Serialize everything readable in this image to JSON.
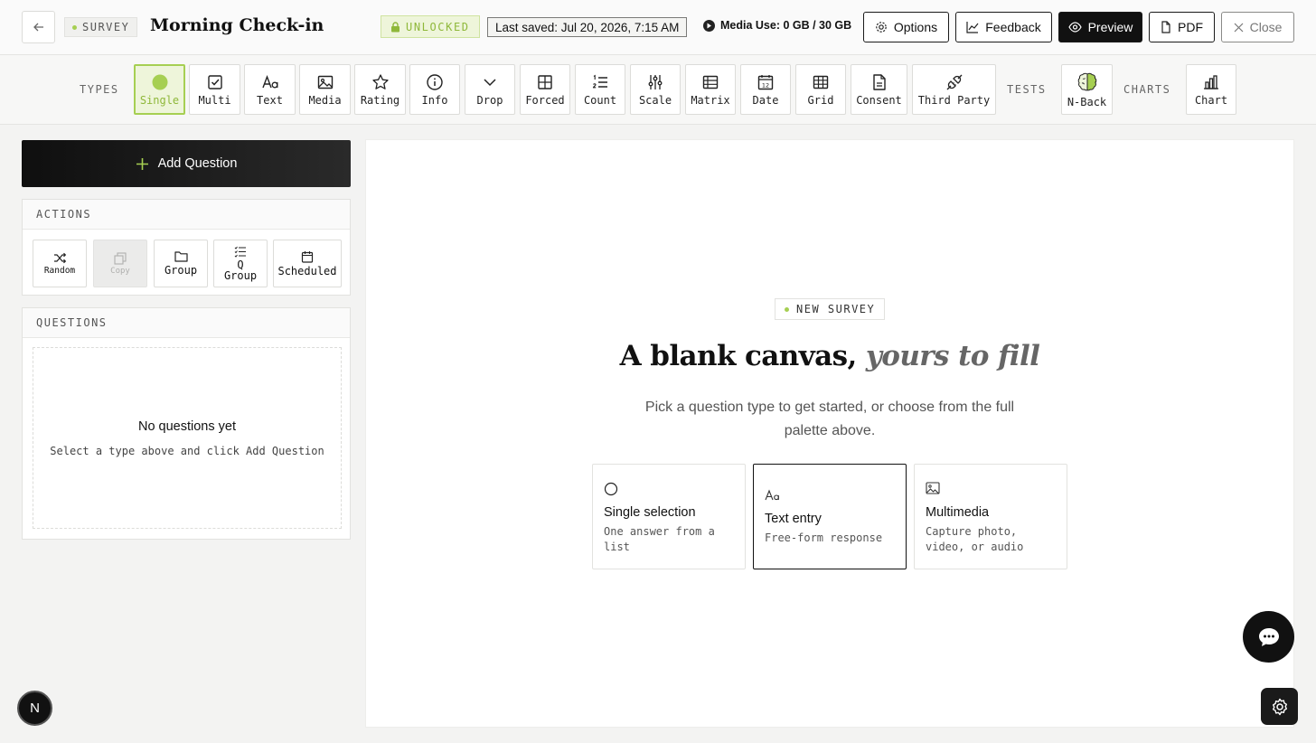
{
  "header": {
    "survey_tag": "SURVEY",
    "title": "Morning Check-in",
    "lock_status": "UNLOCKED",
    "last_saved": "Last saved: Jul 20, 2026, 7:15 AM",
    "media_use": "Media Use: 0 GB / 30 GB",
    "buttons": {
      "options": "Options",
      "feedback": "Feedback",
      "preview": "Preview",
      "pdf": "PDF",
      "close": "Close"
    }
  },
  "toolbar": {
    "types_label": "TYPES",
    "tests_label": "TESTS",
    "charts_label": "CHARTS",
    "types": [
      {
        "label": "Single",
        "icon": "radio-filled-icon",
        "active": true
      },
      {
        "label": "Multi",
        "icon": "checkbox-icon"
      },
      {
        "label": "Text",
        "icon": "text-aa-icon"
      },
      {
        "label": "Media",
        "icon": "image-icon"
      },
      {
        "label": "Rating",
        "icon": "star-icon"
      },
      {
        "label": "Info",
        "icon": "info-icon"
      },
      {
        "label": "Drop",
        "icon": "chevron-down-icon"
      },
      {
        "label": "Forced",
        "icon": "grid-icon"
      },
      {
        "label": "Count",
        "icon": "numbered-list-icon"
      },
      {
        "label": "Scale",
        "icon": "sliders-icon"
      },
      {
        "label": "Matrix",
        "icon": "matrix-icon"
      },
      {
        "label": "Date",
        "icon": "calendar-icon"
      },
      {
        "label": "Grid",
        "icon": "table-icon"
      },
      {
        "label": "Consent",
        "icon": "document-icon"
      },
      {
        "label": "Third Party",
        "icon": "plug-icon"
      }
    ],
    "tests": [
      {
        "label": "N-Back",
        "icon": "brain-icon"
      }
    ],
    "charts": [
      {
        "label": "Chart",
        "icon": "bar-chart-icon"
      }
    ]
  },
  "sidebar": {
    "add_question": "Add Question",
    "actions_label": "ACTIONS",
    "actions": [
      {
        "label": "Random",
        "icon": "shuffle-icon"
      },
      {
        "label": "Copy",
        "icon": "copy-icon",
        "disabled": true
      },
      {
        "label": "Group",
        "icon": "folder-icon"
      },
      {
        "label_line1": "Q",
        "label_line2": "Group",
        "icon": "checklist-icon"
      },
      {
        "label": "Scheduled",
        "icon": "calendar-icon"
      }
    ],
    "questions_label": "QUESTIONS",
    "empty_title": "No questions yet",
    "empty_hint": "Select a type above and click Add Question"
  },
  "canvas": {
    "badge": "NEW SURVEY",
    "headline_main": "A blank canvas, ",
    "headline_italic": "yours to fill",
    "subtitle": "Pick a question type to get started, or choose from the full palette above.",
    "cards": [
      {
        "title": "Single selection",
        "desc": "One answer from a list",
        "icon": "radio-icon"
      },
      {
        "title": "Text entry",
        "desc": "Free-form response",
        "icon": "text-aa-icon",
        "selected": true
      },
      {
        "title": "Multimedia",
        "desc": "Capture photo, video, or audio",
        "icon": "image-icon"
      }
    ]
  },
  "floating": {
    "user_initial": "N"
  },
  "colors": {
    "accent": "#a6cf52",
    "accent_bg": "#eef5da",
    "dark": "#111111"
  }
}
